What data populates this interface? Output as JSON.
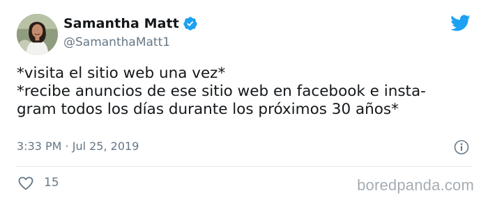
{
  "tweet": {
    "display_name": "Samantha Matt",
    "handle": "@SamanthaMatt1",
    "text_lines": [
      "*visita el sitio web una vez*",
      "*recibe anuncios de ese sitio web en facebook e insta-",
      "gram todos los días durante los próximos 30 años*"
    ],
    "timestamp": "3:33 PM · Jul 25, 2019",
    "like_count": "15"
  },
  "icons": {
    "avatar": "profile-photo",
    "verified": "verified-badge-icon",
    "brand": "twitter-bird-icon",
    "info": "info-icon",
    "like": "heart-icon"
  },
  "colors": {
    "twitter_blue": "#1da1f2",
    "secondary_text": "#657786",
    "primary_text": "#14171a",
    "divider": "#e1e8ed"
  },
  "watermark": "boredpanda.com"
}
